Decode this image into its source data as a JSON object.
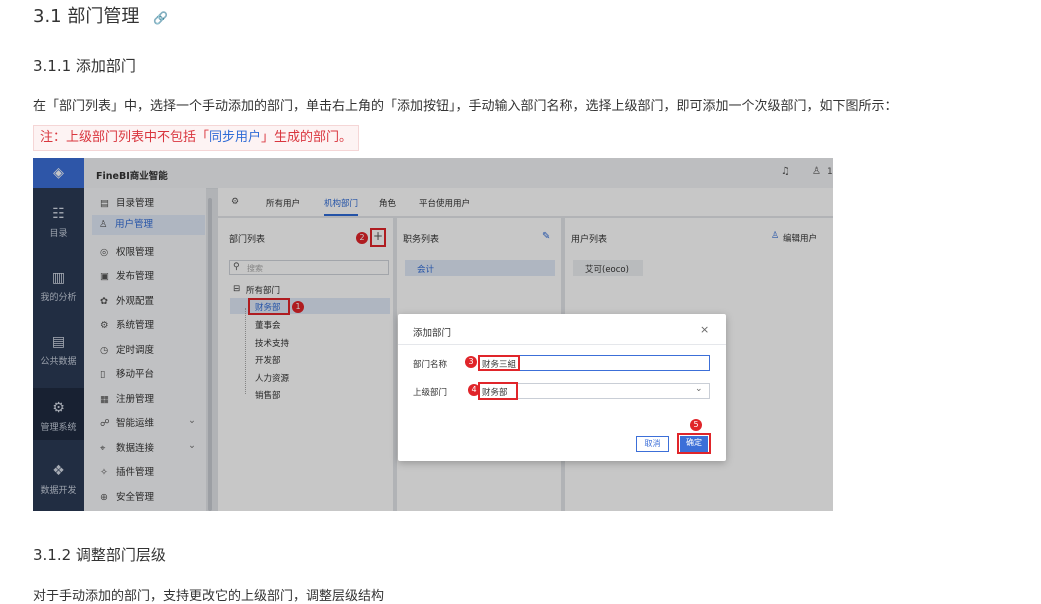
{
  "doc": {
    "h2_title": "3.1 部门管理",
    "h2_link_icon": "link-icon",
    "h3_add": "3.1.1 添加部门",
    "para_add": "在「部门列表」中，选择一个手动添加的部门，单击右上角的「添加按钮」，手动输入部门名称，选择上级部门，即可添加一个次级部门，如下图所示：",
    "note_prefix": "注：上级部门列表中不包括「",
    "note_link": "同步用户",
    "note_suffix": "」生成的部门。",
    "h3_adjust": "3.1.2 调整部门层级",
    "para_adjust": "对于手动添加的部门，支持更改它的上级部门，调整层级结构"
  },
  "screenshot": {
    "app_title": "FineBI商业智能",
    "user_count": "1",
    "leftbar": [
      {
        "icon": "catalog-icon",
        "label": "目录"
      },
      {
        "icon": "analysis-icon",
        "label": "我的分析"
      },
      {
        "icon": "public-data-icon",
        "label": "公共数据"
      },
      {
        "icon": "gear-icon",
        "label": "管理系统"
      },
      {
        "icon": "data-dev-icon",
        "label": "数据开发"
      }
    ],
    "menu": [
      {
        "icon": "▤",
        "label": "目录管理"
      },
      {
        "icon": "♙",
        "label": "用户管理"
      },
      {
        "icon": "◎",
        "label": "权限管理"
      },
      {
        "icon": "▣",
        "label": "发布管理"
      },
      {
        "icon": "✿",
        "label": "外观配置"
      },
      {
        "icon": "⚙",
        "label": "系统管理"
      },
      {
        "icon": "◷",
        "label": "定时调度"
      },
      {
        "icon": "▯",
        "label": "移动平台"
      },
      {
        "icon": "▦",
        "label": "注册管理"
      },
      {
        "icon": "☍",
        "label": "智能运维"
      },
      {
        "icon": "⌖",
        "label": "数据连接"
      },
      {
        "icon": "✧",
        "label": "插件管理"
      },
      {
        "icon": "⊕",
        "label": "安全管理"
      }
    ],
    "tabs": [
      "所有用户",
      "机构部门",
      "角色",
      "平台使用用户"
    ],
    "dept_panel": {
      "title": "部门列表",
      "search_placeholder": "搜索",
      "root": "所有部门",
      "items": [
        "财务部",
        "董事会",
        "技术支持",
        "开发部",
        "人力资源",
        "销售部"
      ]
    },
    "role_panel": {
      "title": "职务列表",
      "items": [
        "会计"
      ]
    },
    "user_panel": {
      "title": "用户列表",
      "edit_label": "编辑用户",
      "items": [
        "艾可(eoco)"
      ]
    },
    "dialog": {
      "title": "添加部门",
      "name_label": "部门名称",
      "name_value": "财务三組",
      "parent_label": "上级部门",
      "parent_value": "财务部",
      "cancel": "取消",
      "confirm": "确定"
    },
    "markers": [
      "1",
      "2",
      "3",
      "4",
      "5"
    ],
    "colors": {
      "accent": "#2f6bd6",
      "marker": "#e0252a",
      "sidebar": "#2b3a55"
    }
  }
}
